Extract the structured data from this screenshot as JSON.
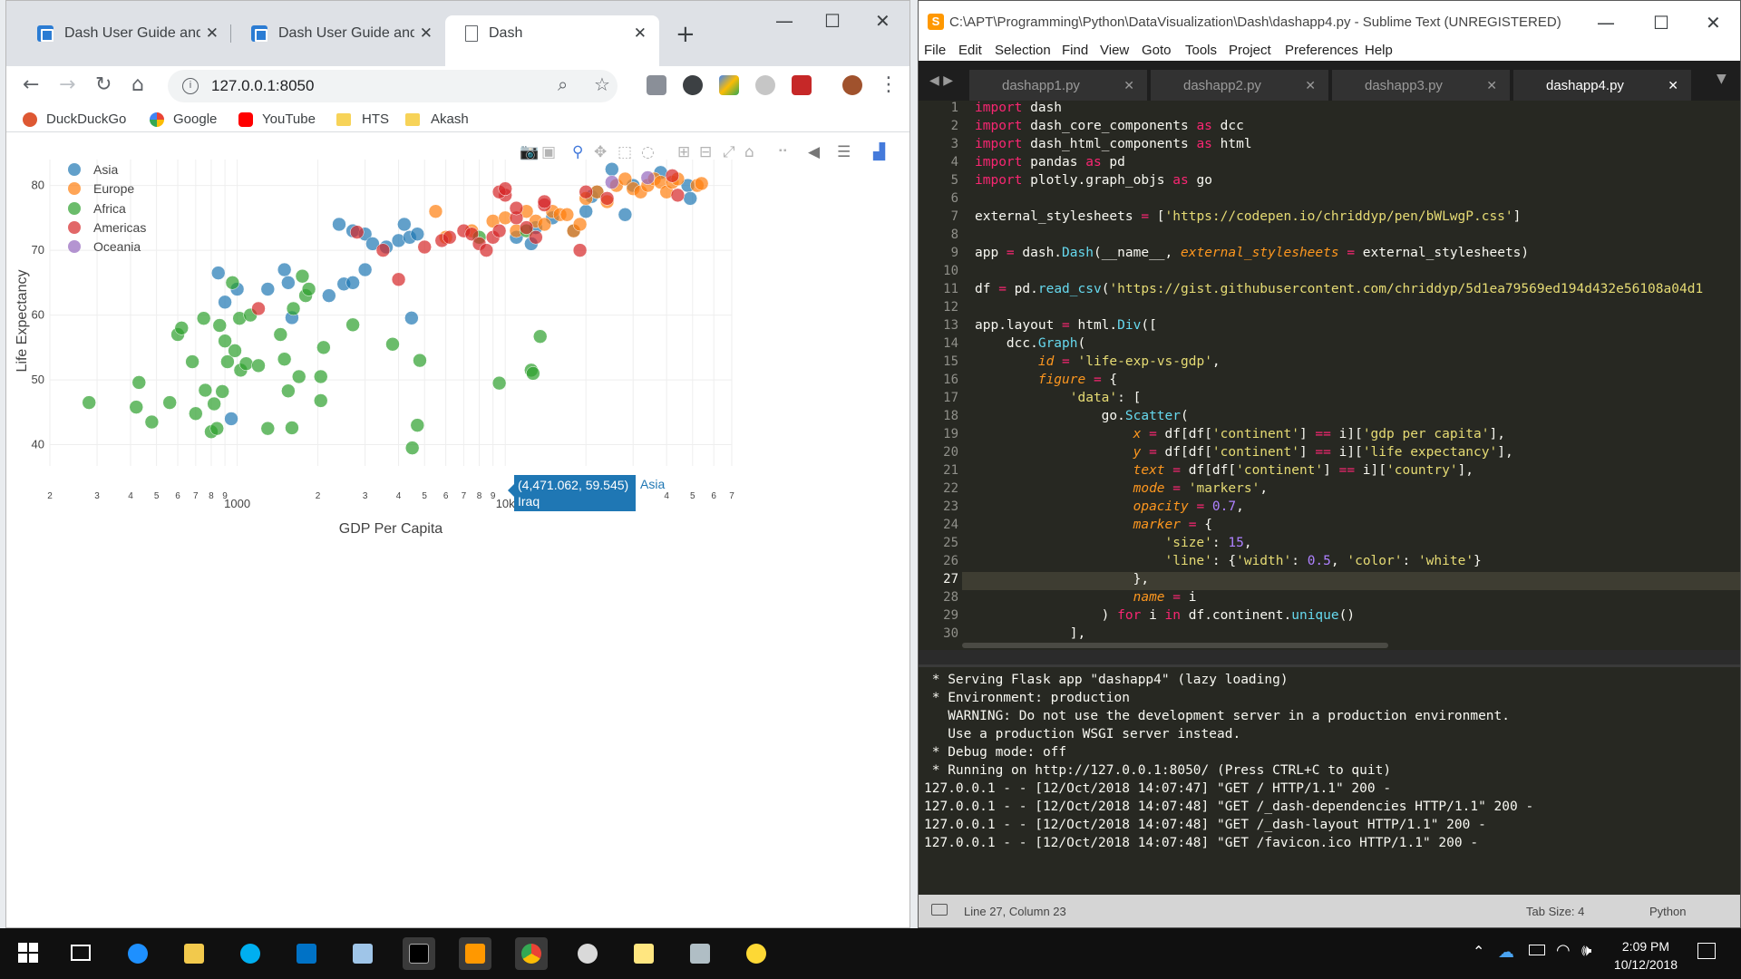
{
  "browser": {
    "tabs": [
      {
        "title": "Dash User Guide and D",
        "active": false
      },
      {
        "title": "Dash User Guide and D",
        "active": false
      },
      {
        "title": "Dash",
        "active": true
      }
    ],
    "url": "127.0.0.1:8050",
    "bookmarks": [
      "DuckDuckGo",
      "Google",
      "YouTube",
      "HTS",
      "Akash"
    ]
  },
  "chart_data": {
    "type": "scatter",
    "title": "",
    "xlabel": "GDP Per Capita",
    "ylabel": "Life Expectancy",
    "x_scale": "log",
    "xlim": [
      200,
      70000
    ],
    "ylim": [
      37,
      84
    ],
    "y_ticks": [
      40,
      50,
      60,
      70,
      80
    ],
    "x_tick_labels": [
      {
        "v": 200,
        "t": "2"
      },
      {
        "v": 300,
        "t": "3"
      },
      {
        "v": 400,
        "t": "4"
      },
      {
        "v": 500,
        "t": "5"
      },
      {
        "v": 600,
        "t": "6"
      },
      {
        "v": 700,
        "t": "7"
      },
      {
        "v": 800,
        "t": "8"
      },
      {
        "v": 900,
        "t": "9"
      },
      {
        "v": 1000,
        "t": "1000"
      },
      {
        "v": 2000,
        "t": "2"
      },
      {
        "v": 3000,
        "t": "3"
      },
      {
        "v": 4000,
        "t": "4"
      },
      {
        "v": 5000,
        "t": "5"
      },
      {
        "v": 6000,
        "t": "6"
      },
      {
        "v": 7000,
        "t": "7"
      },
      {
        "v": 8000,
        "t": "8"
      },
      {
        "v": 9000,
        "t": "9"
      },
      {
        "v": 10000,
        "t": "10k"
      },
      {
        "v": 20000,
        "t": "2"
      },
      {
        "v": 30000,
        "t": "3"
      },
      {
        "v": 40000,
        "t": "4"
      },
      {
        "v": 50000,
        "t": "5"
      },
      {
        "v": 60000,
        "t": "6"
      },
      {
        "v": 70000,
        "t": "7"
      }
    ],
    "legend_position": "top-left",
    "grid": true,
    "series": [
      {
        "name": "Asia",
        "color": "#1f77b4",
        "points": [
          [
            2400,
            74
          ],
          [
            2700,
            73
          ],
          [
            3000,
            72.5
          ],
          [
            3200,
            71
          ],
          [
            3600,
            70.5
          ],
          [
            4000,
            71.5
          ],
          [
            4200,
            74
          ],
          [
            4400,
            72
          ],
          [
            4700,
            72.5
          ],
          [
            1300,
            64
          ],
          [
            1500,
            67
          ],
          [
            1550,
            65
          ],
          [
            1600,
            59.6
          ],
          [
            850,
            66.5
          ],
          [
            900,
            62
          ],
          [
            1000,
            64
          ],
          [
            2200,
            63
          ],
          [
            2500,
            64.8
          ],
          [
            2700,
            65
          ],
          [
            3000,
            67
          ],
          [
            950,
            44
          ],
          [
            4471,
            59.545
          ],
          [
            11000,
            72
          ],
          [
            12500,
            71
          ],
          [
            13000,
            73.5
          ],
          [
            15000,
            75
          ],
          [
            18000,
            73
          ],
          [
            20000,
            76
          ],
          [
            21000,
            78.3
          ],
          [
            22000,
            79
          ],
          [
            25000,
            82.5
          ],
          [
            28000,
            75.5
          ],
          [
            30000,
            80
          ],
          [
            38000,
            82
          ],
          [
            48000,
            80
          ],
          [
            49000,
            78
          ]
        ]
      },
      {
        "name": "Europe",
        "color": "#ff7f0e",
        "points": [
          [
            5500,
            76
          ],
          [
            6000,
            72
          ],
          [
            7500,
            73
          ],
          [
            9000,
            74.5
          ],
          [
            10000,
            75
          ],
          [
            11000,
            73
          ],
          [
            12000,
            76
          ],
          [
            13000,
            74.5
          ],
          [
            14000,
            74
          ],
          [
            15000,
            76
          ],
          [
            16000,
            75.5
          ],
          [
            17000,
            75.5
          ],
          [
            18000,
            73
          ],
          [
            19000,
            74
          ],
          [
            20000,
            78
          ],
          [
            22000,
            79
          ],
          [
            24000,
            77.5
          ],
          [
            26000,
            80
          ],
          [
            28000,
            81
          ],
          [
            30000,
            79.5
          ],
          [
            32000,
            79
          ],
          [
            34000,
            80
          ],
          [
            36000,
            81
          ],
          [
            38000,
            80.5
          ],
          [
            40000,
            79
          ],
          [
            42000,
            80.5
          ],
          [
            44000,
            81
          ],
          [
            52000,
            80
          ],
          [
            54000,
            80.3
          ]
        ]
      },
      {
        "name": "Africa",
        "color": "#2ca02c",
        "points": [
          [
            280,
            46.5
          ],
          [
            420,
            45.8
          ],
          [
            430,
            49.6
          ],
          [
            480,
            43.5
          ],
          [
            560,
            46.5
          ],
          [
            600,
            57
          ],
          [
            620,
            58
          ],
          [
            680,
            52.8
          ],
          [
            700,
            44.8
          ],
          [
            750,
            59.5
          ],
          [
            760,
            48.4
          ],
          [
            800,
            42
          ],
          [
            820,
            46.3
          ],
          [
            840,
            42.5
          ],
          [
            860,
            58.4
          ],
          [
            880,
            48.2
          ],
          [
            900,
            56
          ],
          [
            920,
            52.8
          ],
          [
            960,
            65
          ],
          [
            980,
            54.5
          ],
          [
            1020,
            59.5
          ],
          [
            1030,
            51.5
          ],
          [
            1080,
            52.5
          ],
          [
            1120,
            60
          ],
          [
            1200,
            52.2
          ],
          [
            1300,
            42.5
          ],
          [
            1450,
            57
          ],
          [
            1500,
            53.2
          ],
          [
            1550,
            48.3
          ],
          [
            1600,
            42.6
          ],
          [
            1620,
            61
          ],
          [
            1700,
            50.5
          ],
          [
            1750,
            66
          ],
          [
            1800,
            63
          ],
          [
            1850,
            64
          ],
          [
            2050,
            50.5
          ],
          [
            2100,
            55
          ],
          [
            2050,
            46.8
          ],
          [
            2700,
            58.5
          ],
          [
            3800,
            55.5
          ],
          [
            4500,
            39.5
          ],
          [
            4700,
            43
          ],
          [
            4800,
            53
          ],
          [
            9500,
            49.5
          ],
          [
            12000,
            73
          ],
          [
            12500,
            51.5
          ],
          [
            12700,
            51
          ],
          [
            13500,
            56.7
          ],
          [
            8000,
            72
          ]
        ]
      },
      {
        "name": "Americas",
        "color": "#d62728",
        "points": [
          [
            1200,
            61
          ],
          [
            2800,
            72.8
          ],
          [
            3500,
            70
          ],
          [
            4000,
            65.5
          ],
          [
            5000,
            70.5
          ],
          [
            5800,
            71.5
          ],
          [
            6200,
            72
          ],
          [
            7000,
            73
          ],
          [
            7500,
            72.5
          ],
          [
            8000,
            71
          ],
          [
            8500,
            70
          ],
          [
            9000,
            72
          ],
          [
            9500,
            73
          ],
          [
            10000,
            78.5
          ],
          [
            11000,
            75
          ],
          [
            12000,
            73.5
          ],
          [
            13000,
            72
          ],
          [
            14000,
            77
          ],
          [
            9500,
            79
          ],
          [
            10000,
            79.5
          ],
          [
            11000,
            76.5
          ],
          [
            14000,
            77.5
          ],
          [
            19000,
            70
          ],
          [
            20000,
            79
          ],
          [
            24000,
            78
          ],
          [
            42000,
            81.5
          ],
          [
            44000,
            78.5
          ]
        ]
      },
      {
        "name": "Oceania",
        "color": "#9467bd",
        "points": [
          [
            25000,
            80.5
          ],
          [
            34000,
            81.2
          ]
        ]
      }
    ],
    "hover": {
      "label": "(4,471.062, 59.545)",
      "country": "Iraq",
      "series": "Asia"
    }
  },
  "sublime": {
    "title": "C:\\APT\\Programming\\Python\\DataVisualization\\Dash\\dashapp4.py - Sublime Text (UNREGISTERED)",
    "menu": [
      "File",
      "Edit",
      "Selection",
      "Find",
      "View",
      "Goto",
      "Tools",
      "Project",
      "Preferences",
      "Help"
    ],
    "tabs": [
      "dashapp1.py",
      "dashapp2.py",
      "dashapp3.py",
      "dashapp4.py"
    ],
    "line_numbers": [
      "1",
      "2",
      "3",
      "4",
      "5",
      "6",
      "7",
      "8",
      "9",
      "10",
      "11",
      "12",
      "13",
      "14",
      "15",
      "16",
      "17",
      "18",
      "19",
      "20",
      "21",
      "22",
      "23",
      "24",
      "25",
      "26",
      "27",
      "28",
      "29",
      "30"
    ],
    "console": [
      " * Serving Flask app \"dashapp4\" (lazy loading)",
      " * Environment: production",
      "   WARNING: Do not use the development server in a production environment.",
      "   Use a production WSGI server instead.",
      " * Debug mode: off",
      " * Running on http://127.0.0.1:8050/ (Press CTRL+C to quit)",
      "127.0.0.1 - - [12/Oct/2018 14:07:47] \"GET / HTTP/1.1\" 200 -",
      "127.0.0.1 - - [12/Oct/2018 14:07:48] \"GET /_dash-dependencies HTTP/1.1\" 200 -",
      "127.0.0.1 - - [12/Oct/2018 14:07:48] \"GET /_dash-layout HTTP/1.1\" 200 -",
      "127.0.0.1 - - [12/Oct/2018 14:07:48] \"GET /favicon.ico HTTP/1.1\" 200 -"
    ],
    "status_position": "Line 27, Column 23",
    "status_tab": "Tab Size: 4",
    "status_syntax": "Python"
  },
  "taskbar": {
    "time": "2:09 PM",
    "date": "10/12/2018"
  }
}
